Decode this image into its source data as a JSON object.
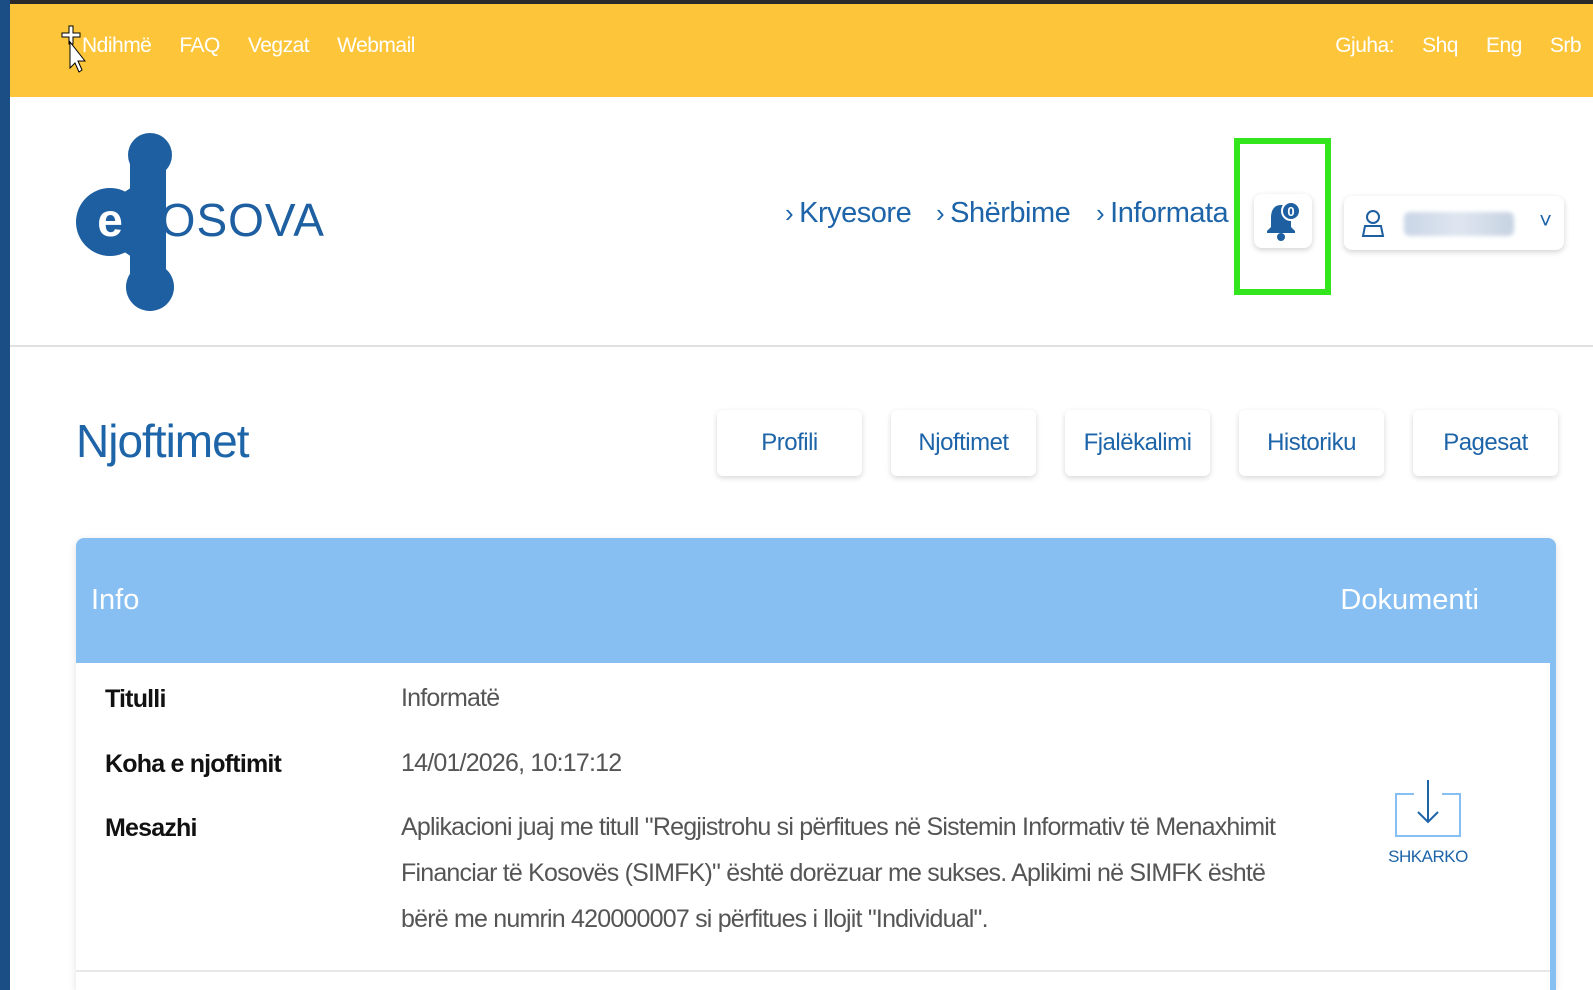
{
  "topbar": {
    "links": [
      "Ndihmë",
      "FAQ",
      "Vegzat",
      "Webmail"
    ],
    "language_label": "Gjuha:",
    "languages": [
      "Shq",
      "Eng",
      "Srb"
    ]
  },
  "logo": {
    "letter": "e",
    "text": "KOSOVA"
  },
  "nav": {
    "items": [
      "Kryesore",
      "Shërbime",
      "Informata"
    ]
  },
  "notifications": {
    "count": "0"
  },
  "page": {
    "title": "Njoftimet"
  },
  "tabs": [
    "Profili",
    "Njoftimet",
    "Fjalëkalimi",
    "Historiku",
    "Pagesat"
  ],
  "table": {
    "header_info": "Info",
    "header_document": "Dokumenti",
    "rows": [
      {
        "label": "Titulli",
        "value": "Informatë"
      },
      {
        "label": "Koha e njoftimit",
        "value": "14/01/2026, 10:17:12"
      },
      {
        "label": "Mesazhi",
        "value": "Aplikacioni juaj me titull \"Regjistrohu si përfitues në Sistemin Informativ të Menaxhimit Financiar të Kosovës (SIMFK)\" është dorëzuar me sukses. Aplikimi në SIMFK është bërë me numrin 420000007 si përfitues i llojit \"Individual\"."
      }
    ],
    "download_label": "SHKARKO"
  },
  "colors": {
    "topbar": "#fdc63a",
    "brand_blue": "#1d64a8",
    "table_header": "#87bff3",
    "highlight": "#32e51d"
  }
}
